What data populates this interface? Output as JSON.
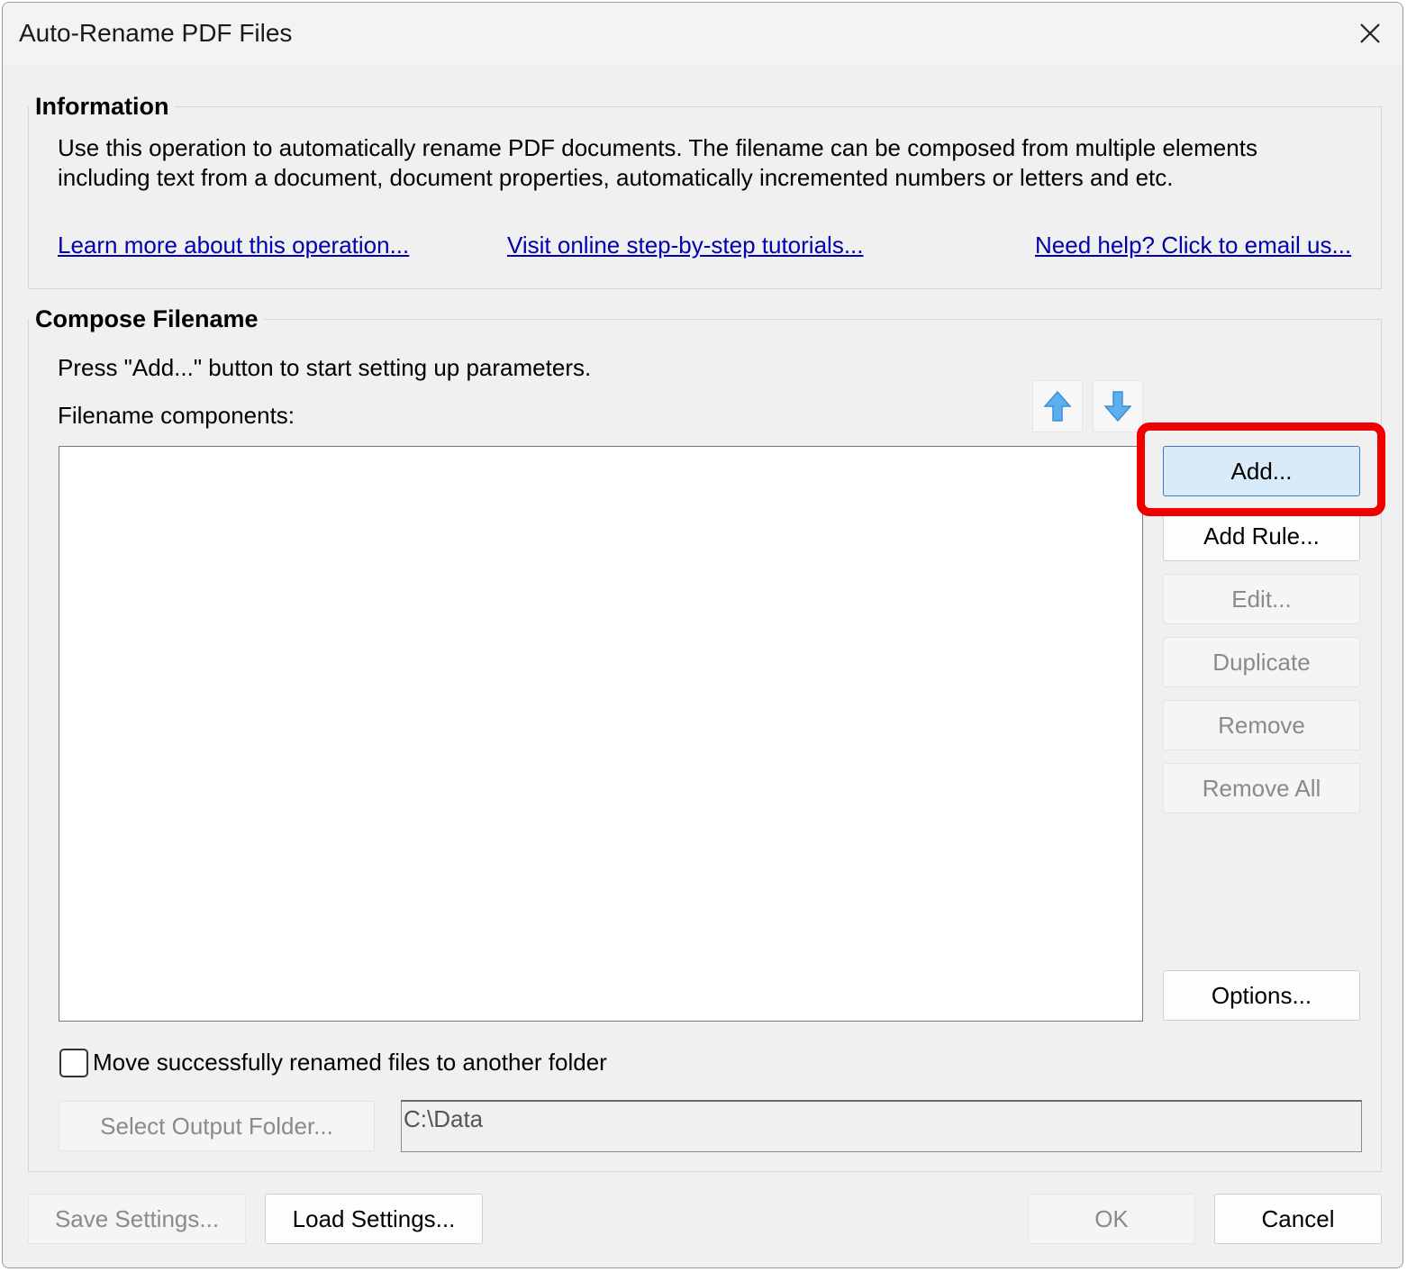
{
  "window": {
    "title": "Auto-Rename PDF Files"
  },
  "information": {
    "heading": "Information",
    "line1": "Use this operation to automatically rename PDF documents. The filename can be composed from multiple elements",
    "line2": "including text from a document, document properties, automatically incremented numbers or letters and etc.",
    "links": {
      "learn_more": "Learn more about this operation...",
      "tutorials": "Visit online step-by-step tutorials...",
      "help": "Need help? Click to email us..."
    }
  },
  "compose": {
    "heading": "Compose Filename",
    "instruction": "Press \"Add...\" button to start setting up parameters.",
    "components_label": "Filename components:",
    "components": [],
    "buttons": {
      "add": "Add...",
      "add_rule": "Add Rule...",
      "edit": "Edit...",
      "duplicate": "Duplicate",
      "remove": "Remove",
      "remove_all": "Remove All",
      "options": "Options..."
    },
    "move_checkbox_label": "Move successfully renamed files to another folder",
    "move_checked": false,
    "select_output_folder": "Select Output Folder...",
    "output_folder": "C:\\Data"
  },
  "footer": {
    "save_settings": "Save Settings...",
    "load_settings": "Load Settings...",
    "ok": "OK",
    "cancel": "Cancel"
  },
  "colors": {
    "link": "#0000b0",
    "highlight": "#ee0000",
    "primary_button": "#d9ebf9",
    "arrow_icon": "#4aa3e8"
  }
}
